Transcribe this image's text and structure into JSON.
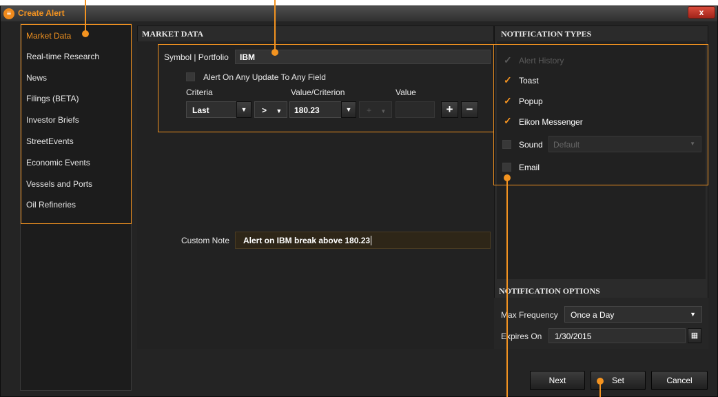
{
  "window": {
    "title": "Create Alert",
    "close_label": "x"
  },
  "sidebar": {
    "items": [
      {
        "label": "Market Data",
        "active": true
      },
      {
        "label": "Real-time Research"
      },
      {
        "label": "News"
      },
      {
        "label": "Filings (BETA)"
      },
      {
        "label": "Investor Briefs"
      },
      {
        "label": "StreetEvents"
      },
      {
        "label": "Economic Events"
      },
      {
        "label": "Vessels and Ports"
      },
      {
        "label": "Oil Refineries"
      }
    ]
  },
  "market": {
    "heading": "MARKET DATA",
    "symbol_label": "Symbol | Portfolio",
    "symbol_value": "IBM",
    "any_update_label": "Alert On Any Update To Any Field",
    "criteria_header": "Criteria",
    "value_criterion_header": "Value/Criterion",
    "value_header": "Value",
    "criteria_value": "Last",
    "operator_value": ">",
    "value_criterion_value": "180.23",
    "disabled_op": "+",
    "add_label": "+",
    "remove_label": "−",
    "custom_note_label": "Custom Note",
    "custom_note_value": "Alert on IBM break above 180.23"
  },
  "notify": {
    "heading": "NOTIFICATION TYPES",
    "alert_history": "Alert History",
    "toast": "Toast",
    "popup": "Popup",
    "eikon": "Eikon Messenger",
    "sound": "Sound",
    "sound_value": "Default",
    "email": "Email"
  },
  "options": {
    "heading": "NOTIFICATION OPTIONS",
    "max_freq_label": "Max Frequency",
    "max_freq_value": "Once a Day",
    "expires_label": "Expires On",
    "expires_value": "1/30/2015"
  },
  "footer": {
    "next": "Next",
    "set": "Set",
    "cancel": "Cancel"
  },
  "icons": {
    "check": "checkmark-icon",
    "dropdown": "chevron-down-icon",
    "calendar": "calendar-icon"
  },
  "colors": {
    "accent": "#f39320",
    "background": "#242424"
  }
}
